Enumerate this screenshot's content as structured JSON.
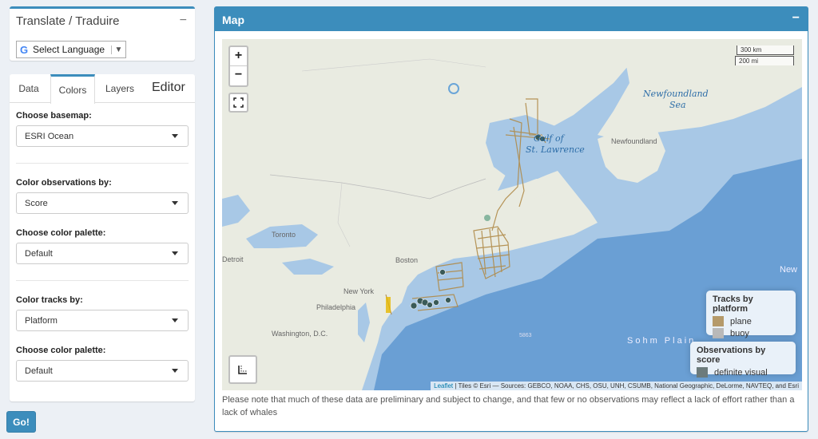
{
  "translate": {
    "title": "Translate / Traduire",
    "collapse_symbol": "−",
    "google_icon": "G",
    "select_label": "Select Language",
    "dropdown_symbol": "▼"
  },
  "editor": {
    "tabs": [
      "Data",
      "Colors",
      "Layers"
    ],
    "active_tab": "Colors",
    "title": "Editor",
    "basemap_label": "Choose basemap:",
    "basemap_value": "ESRI Ocean",
    "obs_color_label": "Color observations by:",
    "obs_color_value": "Score",
    "obs_palette_label": "Choose color palette:",
    "obs_palette_value": "Default",
    "tracks_color_label": "Color tracks by:",
    "tracks_color_value": "Platform",
    "tracks_palette_label": "Choose color palette:",
    "tracks_palette_value": "Default"
  },
  "go_button": "Go!",
  "map_panel": {
    "title": "Map",
    "collapse_symbol": "−",
    "zoom_in": "+",
    "zoom_out": "−",
    "scale_km": "300 km",
    "scale_mi": "200 mi",
    "labels": {
      "newfoundland_sea": "Newfoundland",
      "newfoundland_sea2": "Sea",
      "gulf": "Gulf of",
      "gulf2": "St. Lawrence",
      "newfoundland": "Newfoundland",
      "toronto": "Toronto",
      "detroit": "Detroit",
      "boston": "Boston",
      "new_york": "New York",
      "philadelphia": "Philadelphia",
      "washington": "Washington, D.C.",
      "sohm": "Sohm Plain",
      "new_edge": "New",
      "depth": "5863"
    },
    "legend_tracks": {
      "title": "Tracks by platform",
      "items": [
        {
          "label": "plane",
          "color": "#b59a6a"
        },
        {
          "label": "buoy",
          "color": "#b9b9b9"
        }
      ]
    },
    "legend_obs": {
      "title": "Observations by score",
      "items": [
        {
          "label": "definite visual",
          "color": "#6c7b7c"
        }
      ]
    },
    "attribution_link": "Leaflet",
    "attribution_text": " | Tiles © Esri — Sources: GEBCO, NOAA, CHS, OSU, UNH, CSUMB, National Geographic, DeLorme, NAVTEQ, and Esri",
    "note": "Please note that much of these data are preliminary and subject to change, and that few or no observations may reflect a lack of effort rather than a lack of whales"
  },
  "colors": {
    "accent": "#3c8dbc",
    "land": "#e9ebe1",
    "ocean_deep": "#6a9fd4",
    "shelf": "#a8c8e6",
    "track": "#b08a48"
  }
}
